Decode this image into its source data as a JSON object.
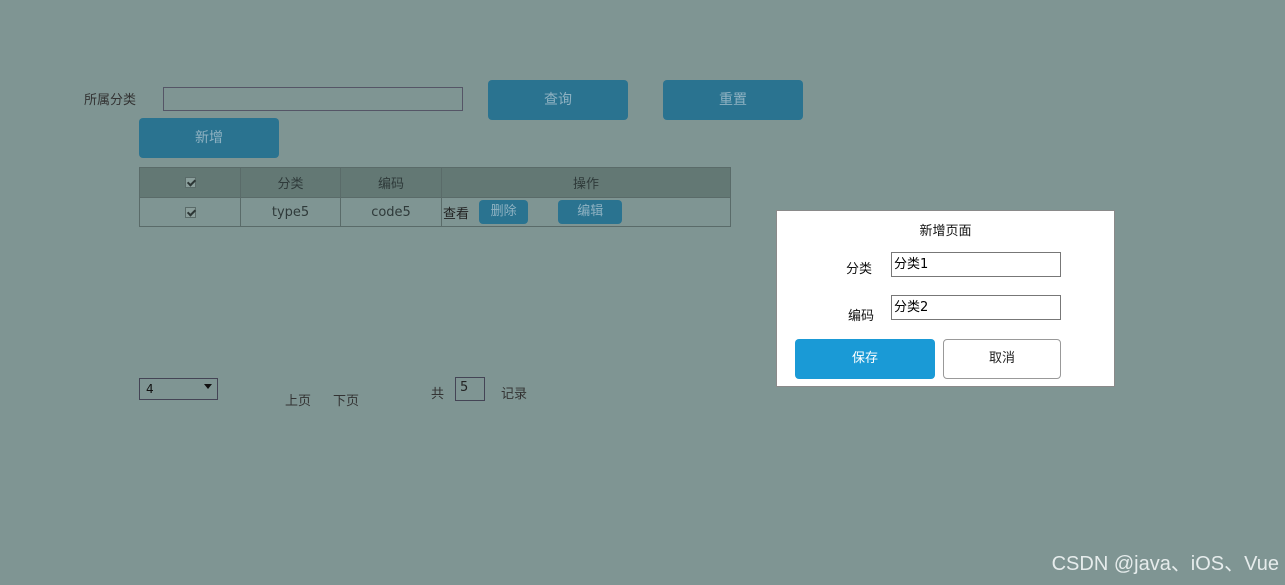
{
  "search": {
    "label": "所属分类",
    "value": "",
    "query_label": "查询",
    "reset_label": "重置",
    "add_label": "新增"
  },
  "table": {
    "headers": [
      "分类",
      "编码",
      "操作"
    ],
    "rows": [
      {
        "category": "type5",
        "code": "code5",
        "view_label": "查看",
        "delete_label": "删除",
        "edit_label": "编辑"
      }
    ]
  },
  "pagination": {
    "page_size": "4",
    "prev_label": "上页",
    "next_label": "下页",
    "total_prefix": "共",
    "total_value": "5",
    "total_suffix": "记录"
  },
  "dialog": {
    "title": "新增页面",
    "category_label": "分类",
    "category_value": "分类1",
    "code_label": "编码",
    "code_value": "分类2",
    "save_label": "保存",
    "cancel_label": "取消"
  },
  "colors": {
    "overlay_background": "#7f9593",
    "button_dim": "#2a7390",
    "save_button": "#1a9ad6"
  },
  "watermark": "CSDN @java、iOS、Vue"
}
